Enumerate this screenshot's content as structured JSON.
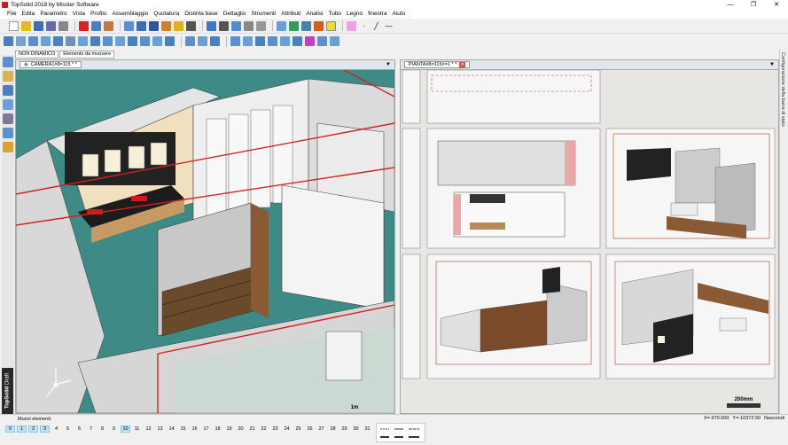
{
  "window": {
    "title": "TopSolid 2018 by Missler Software",
    "controls": [
      "—",
      "❐",
      "✕"
    ]
  },
  "menu": [
    "File",
    "Edita",
    "Parametro",
    "Vista",
    "Profilo",
    "Assemblaggio",
    "Quotatura",
    "Distinta base",
    "Dettaglio",
    "Strumenti",
    "Attributi",
    "Analisi",
    "Tubo",
    "Legno",
    "finestra",
    "Aiuto"
  ],
  "mode_tabs": [
    "NON DINAMICO",
    "Elemento da muovere"
  ],
  "view3d": {
    "tab_label": "CAMERA1#8=115 * *",
    "scale_label": "1m"
  },
  "drawing": {
    "tab_label": "PIANTA#8=115#=1 * *",
    "scale_label": "200mm"
  },
  "right_panel_label": "Configurazione della barra di stato",
  "brand": {
    "name": "TopSolid",
    "sub": "Draft"
  },
  "status": {
    "message": "Muovi elementi.",
    "x": "X=-970.000",
    "y": "Y=-10372.50",
    "hide": "Nascondi"
  },
  "pages": [
    "0",
    "1",
    "2",
    "3",
    "4",
    "5",
    "6",
    "7",
    "8",
    "9",
    "10",
    "11",
    "12",
    "13",
    "14",
    "15",
    "16",
    "17",
    "18",
    "19",
    "20",
    "21",
    "22",
    "23",
    "24",
    "25",
    "26",
    "27",
    "28",
    "29",
    "30",
    "31"
  ],
  "highlighted_pages": [
    "0",
    "1",
    "2",
    "3",
    "10"
  ],
  "colors": {
    "scene_floor": "#3d8a86",
    "wall": "#e8e8e8",
    "cut_line": "#d42020",
    "wood": "#8a5a34"
  }
}
